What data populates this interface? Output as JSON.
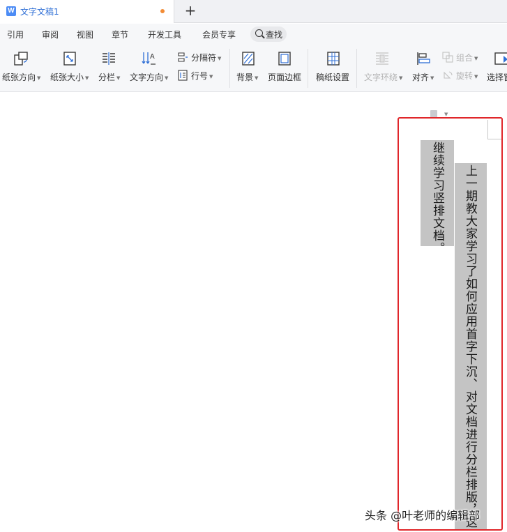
{
  "titlebar": {
    "doc_icon": "W",
    "doc_title": "文字文稿1",
    "add_tab": "+"
  },
  "menu": {
    "items": [
      "引用",
      "审阅",
      "视图",
      "章节",
      "开发工具",
      "会员专享"
    ],
    "search_label": "查找"
  },
  "ribbon": {
    "paper_orientation": "纸张方向",
    "paper_size": "纸张大小",
    "columns": "分栏",
    "text_direction": "文字方向",
    "separator": "分隔符",
    "line_number": "行号",
    "background": "背景",
    "page_border": "页面边框",
    "manuscript_setup": "稿纸设置",
    "text_wrap": "文字环绕",
    "align": "对齐",
    "group": "组合",
    "rotate": "旋转",
    "select_pane": "选择窗"
  },
  "document": {
    "column_right_text": "上一期教大家学习了如何应用首字下沉、对文档进行分栏排版，这一期我们",
    "column_left_text": "继续学习竖排文档。"
  },
  "watermark": "头条 @叶老师的编辑部",
  "colors": {
    "accent": "#2f6fd6",
    "highlight_frame": "#e0262a",
    "selection_fill": "#c4c4c4",
    "unsaved_dot": "#f28b35"
  },
  "icons": [
    "doc-icon",
    "plus-icon",
    "search-icon",
    "paper-orientation-icon",
    "paper-size-icon",
    "columns-icon",
    "text-direction-icon",
    "separator-icon",
    "line-number-icon",
    "background-icon",
    "page-border-icon",
    "manuscript-icon",
    "text-wrap-icon",
    "align-icon",
    "group-icon",
    "rotate-icon",
    "select-pane-icon",
    "anchor-icon"
  ]
}
